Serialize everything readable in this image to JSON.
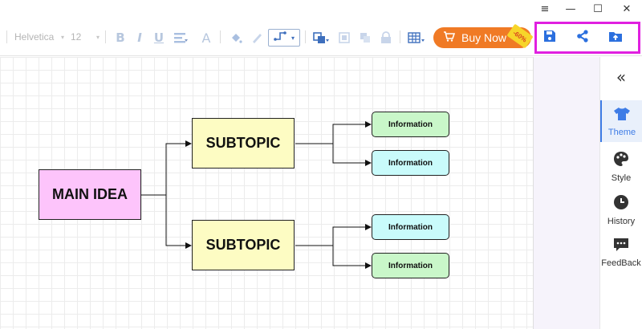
{
  "window": {
    "controls": {
      "menu_glyph": "≡",
      "minimize_glyph": "—",
      "maximize_glyph": "☐",
      "close_glyph": "✕"
    }
  },
  "toolbar": {
    "font_family": "Helvetica",
    "font_size": "12",
    "buy_now_label": "Buy Now",
    "discount_badge": "-60%",
    "icons": [
      "bold-icon",
      "italic-icon",
      "underline-icon",
      "align-icon",
      "font-color-icon",
      "fill-icon",
      "brush-icon",
      "connector-icon",
      "arrange-icon",
      "group-icon",
      "ungroup-icon",
      "lock-icon",
      "table-icon"
    ],
    "actions": [
      "save-icon",
      "share-icon",
      "export-icon"
    ],
    "glyphs": {
      "bold": "B",
      "italic": "I",
      "underline": "U",
      "font_color": "A",
      "caret": "▾"
    }
  },
  "side_panel": {
    "collapse_glyph": "«",
    "items": [
      {
        "label": "Theme",
        "icon": "tshirt-icon",
        "active": true
      },
      {
        "label": "Style",
        "icon": "palette-icon",
        "active": false
      },
      {
        "label": "History",
        "icon": "clock-icon",
        "active": false
      },
      {
        "label": "FeedBack",
        "icon": "chat-icon",
        "active": false
      }
    ]
  },
  "mindmap": {
    "main": "MAIN IDEA",
    "subtopics": [
      {
        "label": "SUBTOPIC",
        "children": [
          "Information",
          "Information"
        ]
      },
      {
        "label": "SUBTOPIC",
        "children": [
          "Information",
          "Information"
        ]
      }
    ]
  },
  "colors": {
    "accent": "#3e7ce6",
    "highlight": "#e020e0",
    "buy_now": "#f07a25",
    "main_node": "#fdc4fb",
    "subtopic_node": "#fdfcc3",
    "info_green": "#c9f7c9",
    "info_cyan": "#c9fbfb"
  }
}
